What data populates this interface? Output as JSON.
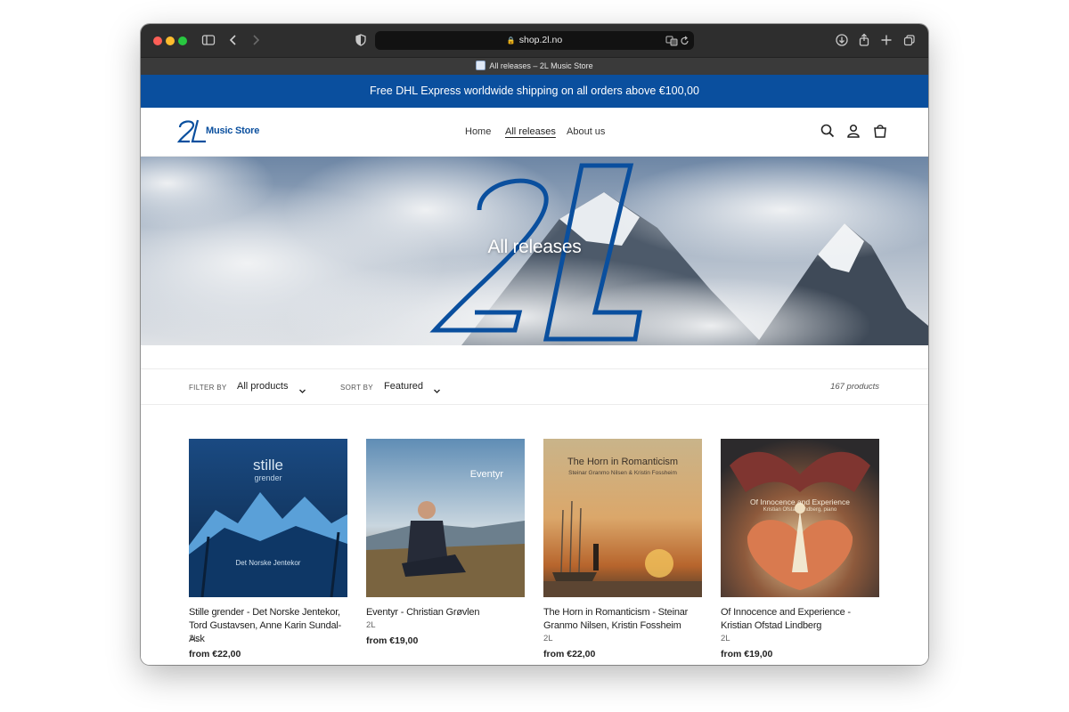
{
  "browser": {
    "url": "shop.2l.no",
    "tab_title": "All releases – 2L Music Store"
  },
  "announcement": "Free DHL Express worldwide shipping on all orders above €100,00",
  "header": {
    "logo_text": "Music Store",
    "nav": [
      "Home",
      "All releases",
      "About us"
    ],
    "active_nav": "All releases"
  },
  "hero": {
    "title": "All releases"
  },
  "filters": {
    "filter_label": "FILTER BY",
    "filter_value": "All products",
    "sort_label": "SORT BY",
    "sort_value": "Featured",
    "count": "167 products"
  },
  "products": [
    {
      "title": "Stille grender - Det Norske Jentekor, Tord Gustavsen, Anne Karin Sundal-Ask",
      "vendor": "2L",
      "price": "from €22,00",
      "cover_title": "stille",
      "cover_subtitle": "grender",
      "cover_footer": "Det Norske Jentekor"
    },
    {
      "title": "Eventyr - Christian Grøvlen",
      "vendor": "2L",
      "price": "from €19,00",
      "cover_title": "Eventyr"
    },
    {
      "title": "The Horn in Romanticism - Steinar Granmo Nilsen, Kristin Fossheim",
      "vendor": "2L",
      "price": "from €22,00",
      "cover_title": "The Horn in Romanticism",
      "cover_subtitle": "Steinar Granmo Nilsen & Kristin Fossheim"
    },
    {
      "title": "Of Innocence and Experience - Kristian Ofstad Lindberg",
      "vendor": "2L",
      "price": "from €19,00",
      "cover_title": "Of Innocence and Experience",
      "cover_subtitle": "Kristian Ofstad Lindberg, piano"
    }
  ],
  "colors": {
    "brand": "#0a4f9e",
    "chrome": "#2e2e2e"
  }
}
